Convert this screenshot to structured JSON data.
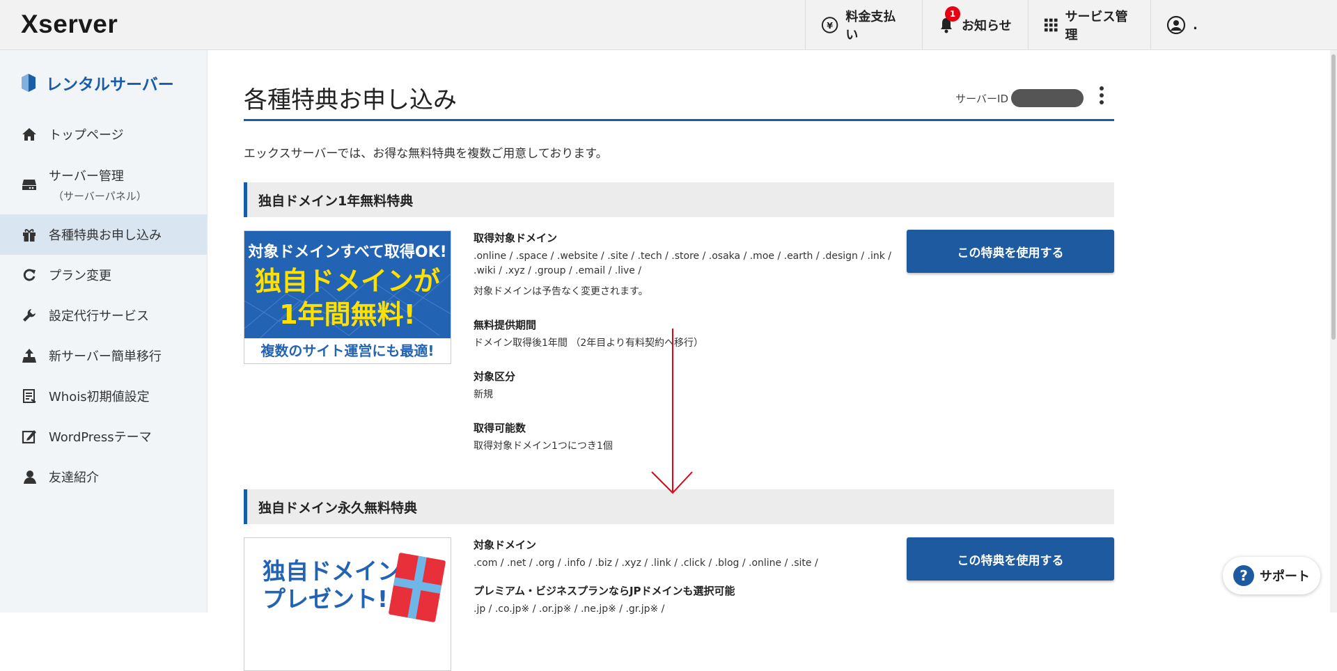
{
  "header": {
    "logo": "Xserver",
    "nav": [
      {
        "label": "料金支払い"
      },
      {
        "label": "お知らせ",
        "badge": "1"
      },
      {
        "label": "サービス管理"
      },
      {
        "label": "."
      }
    ]
  },
  "sidebar": {
    "title": "レンタルサーバー",
    "items": [
      {
        "label": "トップページ",
        "icon": "home-icon"
      },
      {
        "label": "サーバー管理",
        "sub": "（サーバーパネル）",
        "icon": "server-icon"
      },
      {
        "label": "各種特典お申し込み",
        "icon": "gift-icon",
        "active": true
      },
      {
        "label": "プラン変更",
        "icon": "refresh-icon"
      },
      {
        "label": "設定代行サービス",
        "icon": "wrench-icon"
      },
      {
        "label": "新サーバー簡単移行",
        "icon": "upload-icon"
      },
      {
        "label": "Whois初期値設定",
        "icon": "document-icon"
      },
      {
        "label": "WordPressテーマ",
        "icon": "edit-icon"
      },
      {
        "label": "友達紹介",
        "icon": "person-icon"
      }
    ]
  },
  "main": {
    "title": "各種特典お申し込み",
    "server_id_label": "サーバーID",
    "intro": "エックスサーバーでは、お得な無料特典を複数ご用意しております。",
    "sections": [
      {
        "heading": "独自ドメイン1年無料特典",
        "banner": {
          "top": "対象ドメインすべて取得OK!",
          "main1": "独自ドメインが",
          "main2": "1年間無料!",
          "bottom": "複数のサイト運営にも最適!"
        },
        "fields": [
          {
            "label": "取得対象ドメイン",
            "value": ".online / .space / .website / .site / .tech / .store / .osaka / .moe / .earth / .design / .ink / .wiki / .xyz / .group / .email / .live /",
            "note": "対象ドメインは予告なく変更されます。"
          },
          {
            "label": "無料提供期間",
            "value": "ドメイン取得後1年間 （2年目より有料契約へ移行）"
          },
          {
            "label": "対象区分",
            "value": "新規"
          },
          {
            "label": "取得可能数",
            "value": "取得対象ドメイン1つにつき1個"
          }
        ],
        "button": "この特典を使用する"
      },
      {
        "heading": "独自ドメイン永久無料特典",
        "banner": {
          "line1": "独自ドメイン",
          "line2": "プレゼント!"
        },
        "fields": [
          {
            "label": "対象ドメイン",
            "value": ".com / .net / .org / .info / .biz / .xyz / .link / .click / .blog / .online / .site /"
          },
          {
            "label": "プレミアム・ビジネスプランならJPドメインも選択可能",
            "value": ".jp / .co.jp※ / .or.jp※ / .ne.jp※ / .gr.jp※ /"
          }
        ],
        "button": "この特典を使用する"
      }
    ]
  },
  "support": {
    "label": "サポート",
    "icon_glyph": "?"
  },
  "colors": {
    "brand_blue": "#1e5aa0",
    "badge_red": "#e60012",
    "annotation_red": "#e60012"
  }
}
